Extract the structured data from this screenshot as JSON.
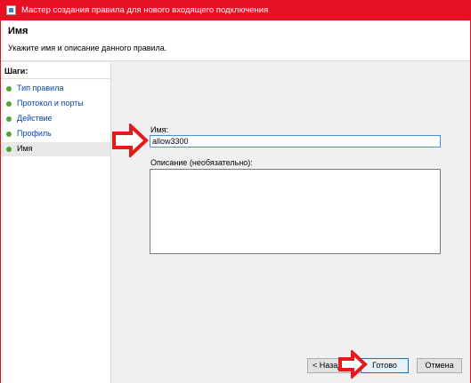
{
  "window": {
    "title": "Мастер создания правила для нового входящего подключения"
  },
  "header": {
    "title": "Имя",
    "subtitle": "Укажите имя и описание данного правила."
  },
  "sidebar": {
    "steps_title": "Шаги:",
    "items": [
      {
        "label": "Тип правила",
        "state": "done"
      },
      {
        "label": "Протокол и порты",
        "state": "done"
      },
      {
        "label": "Действие",
        "state": "done"
      },
      {
        "label": "Профиль",
        "state": "done"
      },
      {
        "label": "Имя",
        "state": "current"
      }
    ]
  },
  "form": {
    "name_label": "Имя:",
    "name_value": "allow3300",
    "description_label": "Описание (необязательно):",
    "description_value": ""
  },
  "buttons": {
    "back_label": "< Назад",
    "finish_label": "Готово",
    "cancel_label": "Отмена"
  },
  "colors": {
    "titlebar": "#e81123",
    "step_dot": "#4ea72e",
    "annotation_arrow": "#e41b1b"
  },
  "icons": {
    "app": "wizard-window-icon",
    "step": "green-dot-icon",
    "annotation": "red-arrow-icon"
  }
}
